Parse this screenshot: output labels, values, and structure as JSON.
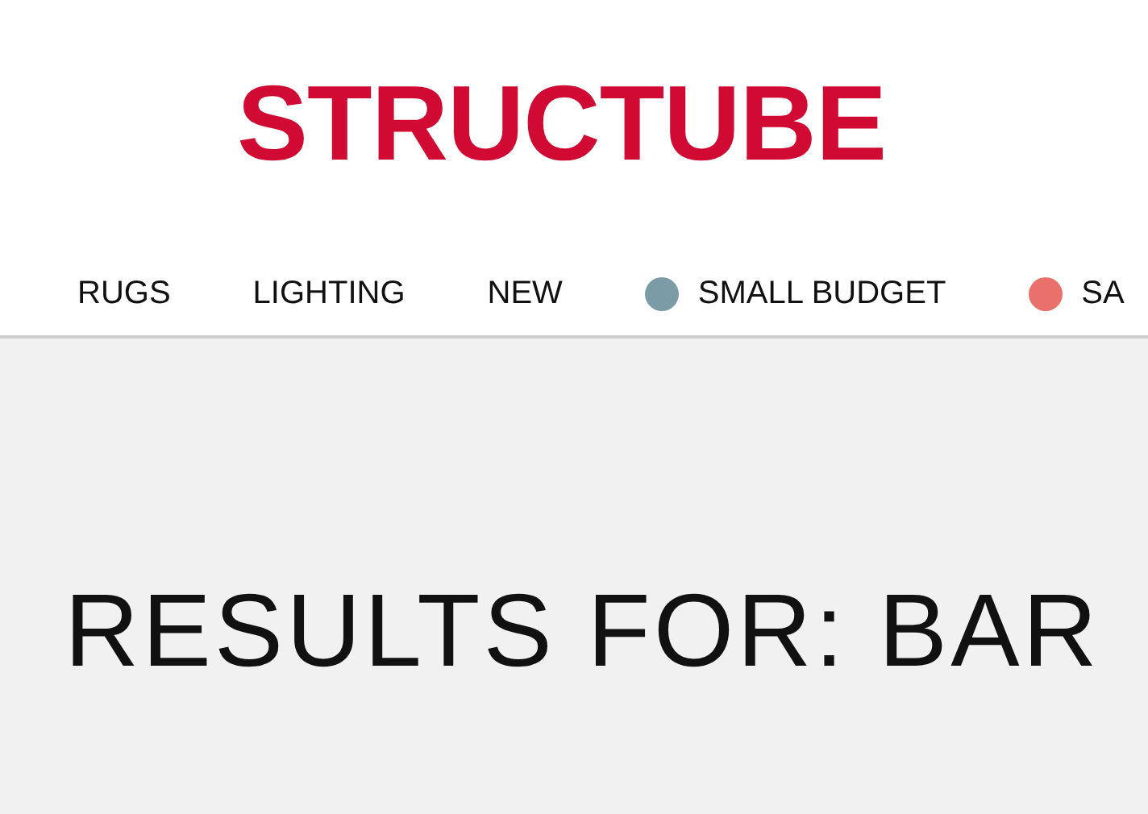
{
  "header": {
    "logo": "STRUCTUBE"
  },
  "nav": [
    {
      "kind": "text",
      "label": "RUGS"
    },
    {
      "kind": "text",
      "label": "LIGHTING"
    },
    {
      "kind": "text",
      "label": "NEW"
    },
    {
      "kind": "dot",
      "label": "SMALL BUDGET",
      "color": "#7b9ba6"
    },
    {
      "kind": "dot",
      "label": "SA",
      "color": "#e9706b"
    }
  ],
  "heading": "RESULTS FOR: BAR"
}
